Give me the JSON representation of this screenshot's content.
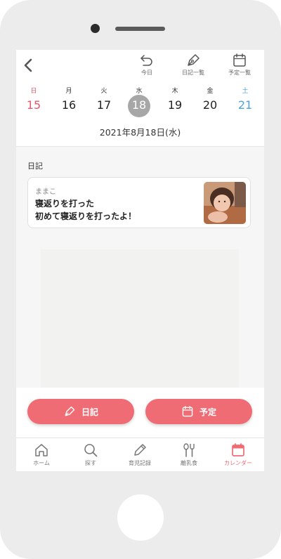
{
  "toolbar": {
    "today_label": "今日",
    "diary_list_label": "日記一覧",
    "schedule_list_label": "予定一覧"
  },
  "calendar": {
    "weekdays": [
      "日",
      "月",
      "火",
      "水",
      "木",
      "金",
      "土"
    ],
    "days": [
      "15",
      "16",
      "17",
      "18",
      "19",
      "20",
      "21"
    ],
    "selected_date": "2021年8月18日(水)"
  },
  "diary": {
    "section_title": "日記",
    "entry": {
      "author": "ままこ",
      "title": "寝返りを打った",
      "body": "初めて寝返りを打ったよ！"
    }
  },
  "actions": {
    "diary_button": "日記",
    "schedule_button": "予定"
  },
  "tabs": [
    {
      "label": "ホーム",
      "icon": "home-icon"
    },
    {
      "label": "探す",
      "icon": "search-icon"
    },
    {
      "label": "育児記録",
      "icon": "pencil-icon"
    },
    {
      "label": "離乳食",
      "icon": "utensils-icon"
    },
    {
      "label": "カレンダー",
      "icon": "calendar-icon"
    }
  ],
  "colors": {
    "accent": "#f06c74",
    "sunday": "#e8576b",
    "saturday": "#4ea3d8",
    "selected_circle": "#a7a7a7"
  }
}
